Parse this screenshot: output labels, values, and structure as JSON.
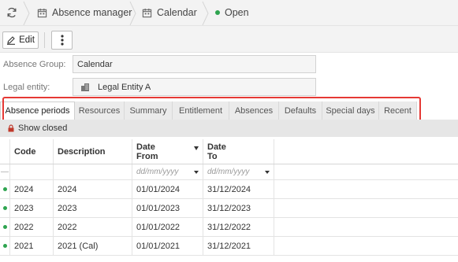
{
  "breadcrumb": {
    "items": [
      {
        "label": "Absence manager"
      },
      {
        "label": "Calendar"
      },
      {
        "label": "Open"
      }
    ]
  },
  "toolbar": {
    "edit_label": "Edit"
  },
  "form": {
    "absence_group_label": "Absence Group:",
    "absence_group_value": "Calendar",
    "legal_entity_label": "Legal entity:",
    "legal_entity_value": "Legal Entity A"
  },
  "tabs": [
    {
      "label": "Absence periods",
      "active": true
    },
    {
      "label": "Resources"
    },
    {
      "label": "Summary"
    },
    {
      "label": "Entitlement"
    },
    {
      "label": "Absences"
    },
    {
      "label": "Defaults"
    },
    {
      "label": "Special days"
    },
    {
      "label": "Recent"
    }
  ],
  "show_closed_label": "Show closed",
  "grid": {
    "columns": [
      "Code",
      "Description",
      "Date From",
      "Date To"
    ],
    "col_date_from_line1": "Date",
    "col_date_from_line2": "From",
    "col_date_to_line1": "Date",
    "col_date_to_line2": "To",
    "filter_placeholder": "dd/mm/yyyy",
    "filter_marker": "—",
    "rows": [
      {
        "code": "2024",
        "description": "2024",
        "from": "01/01/2024",
        "to": "31/12/2024"
      },
      {
        "code": "2023",
        "description": "2023",
        "from": "01/01/2023",
        "to": "31/12/2023"
      },
      {
        "code": "2022",
        "description": "2022",
        "from": "01/01/2022",
        "to": "31/12/2022"
      },
      {
        "code": "2021",
        "description": "2021 (Cal)",
        "from": "01/01/2021",
        "to": "31/12/2021"
      }
    ]
  },
  "colors": {
    "status_green": "#2ea44f",
    "highlight_red": "#e53935"
  },
  "icons": [
    "refresh-icon",
    "calendar-icon",
    "pencil-icon",
    "more-vertical-icon",
    "building-icon",
    "lock-icon"
  ]
}
